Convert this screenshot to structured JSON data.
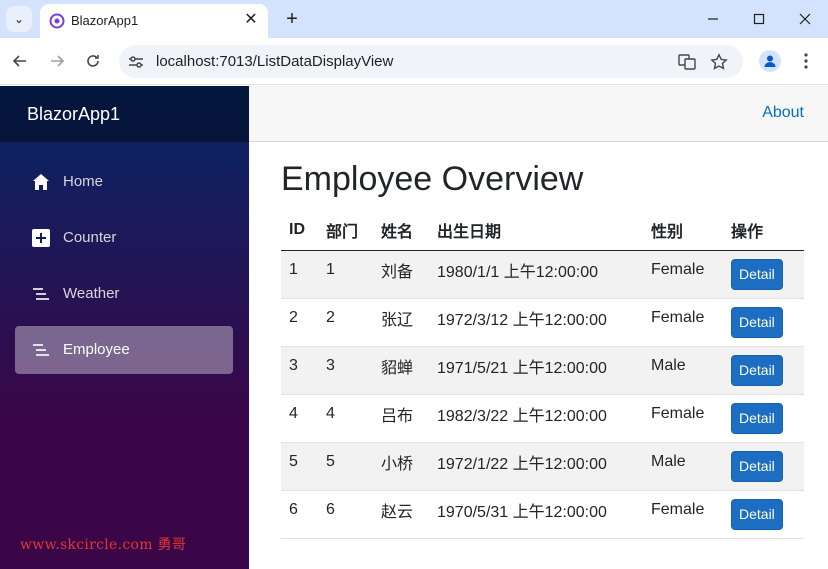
{
  "browser": {
    "tab_title": "BlazorApp1",
    "tab_close": "✕",
    "new_tab": "+",
    "url": "localhost:7013/ListDataDisplayView",
    "window_minimize": "—",
    "window_maximize": "☐",
    "window_close": "✕"
  },
  "sidebar": {
    "brand": "BlazorApp1",
    "items": [
      {
        "label": "Home",
        "icon": "home-icon",
        "active": false
      },
      {
        "label": "Counter",
        "icon": "plus-square-icon",
        "active": false
      },
      {
        "label": "Weather",
        "icon": "list-icon",
        "active": false
      },
      {
        "label": "Employee",
        "icon": "list-icon",
        "active": true
      }
    ],
    "watermark": "www.skcircle.com 勇哥"
  },
  "header": {
    "about": "About"
  },
  "main": {
    "title": "Employee Overview",
    "columns": [
      "ID",
      "部门",
      "姓名",
      "出生日期",
      "性别",
      "操作"
    ],
    "rows": [
      {
        "id": "1",
        "dept": "1",
        "name": "刘备",
        "birth": "1980/1/1 上午12:00:00",
        "gender": "Female",
        "action": "Detail"
      },
      {
        "id": "2",
        "dept": "2",
        "name": "张辽",
        "birth": "1972/3/12 上午12:00:00",
        "gender": "Female",
        "action": "Detail"
      },
      {
        "id": "3",
        "dept": "3",
        "name": "貂蝉",
        "birth": "1971/5/21 上午12:00:00",
        "gender": "Male",
        "action": "Detail"
      },
      {
        "id": "4",
        "dept": "4",
        "name": "吕布",
        "birth": "1982/3/22 上午12:00:00",
        "gender": "Female",
        "action": "Detail"
      },
      {
        "id": "5",
        "dept": "5",
        "name": "小桥",
        "birth": "1972/1/22 上午12:00:00",
        "gender": "Male",
        "action": "Detail"
      },
      {
        "id": "6",
        "dept": "6",
        "name": "赵云",
        "birth": "1970/5/31 上午12:00:00",
        "gender": "Female",
        "action": "Detail"
      }
    ]
  },
  "colors": {
    "accent_button": "#1b6ec2",
    "link": "#0071c1",
    "sidebar_top": "#052767",
    "sidebar_bottom": "#3a0647"
  }
}
